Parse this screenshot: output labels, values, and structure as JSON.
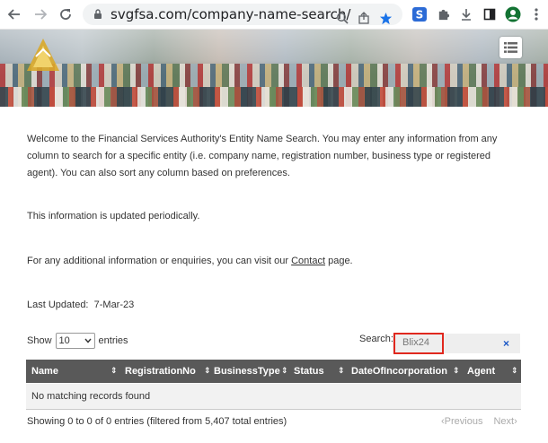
{
  "browser": {
    "url": "svgfsa.com/company-name-search/",
    "url_domain": "svgfsa.com",
    "url_path": "/company-name-search/"
  },
  "intro": {
    "paragraph1": "Welcome to the Financial Services Authority's Entity Name Search. You may enter any information from any column to search for a specific entity (i.e. company name, registration number, business type or registered agent). You can also sort any column based on preferences.",
    "paragraph2": "This information is updated periodically.",
    "paragraph3_prefix": "For any additional information or enquiries, you can visit our ",
    "paragraph3_link": "Contact",
    "paragraph3_suffix": " page.",
    "last_updated_label": "Last Updated:",
    "last_updated_value": "7-Mar-23"
  },
  "table_controls": {
    "show_label": "Show",
    "entries_value": "10",
    "entries_label": "entries",
    "search_label": "Search:",
    "search_value": "Blix24",
    "clear_symbol": "×"
  },
  "table": {
    "columns": [
      "Name",
      "RegistrationNo",
      "BusinessType",
      "Status",
      "DateOfIncorporation",
      "Agent"
    ],
    "empty_message": "No matching records found"
  },
  "footer": {
    "info": "Showing 0 to 0 of 0 entries (filtered from 5,407 total entries)",
    "previous": "Previous",
    "next": "Next"
  },
  "colors": {
    "accent_red": "#d9261c",
    "table_header": "#595959",
    "highlight_box": "#e0281e"
  }
}
